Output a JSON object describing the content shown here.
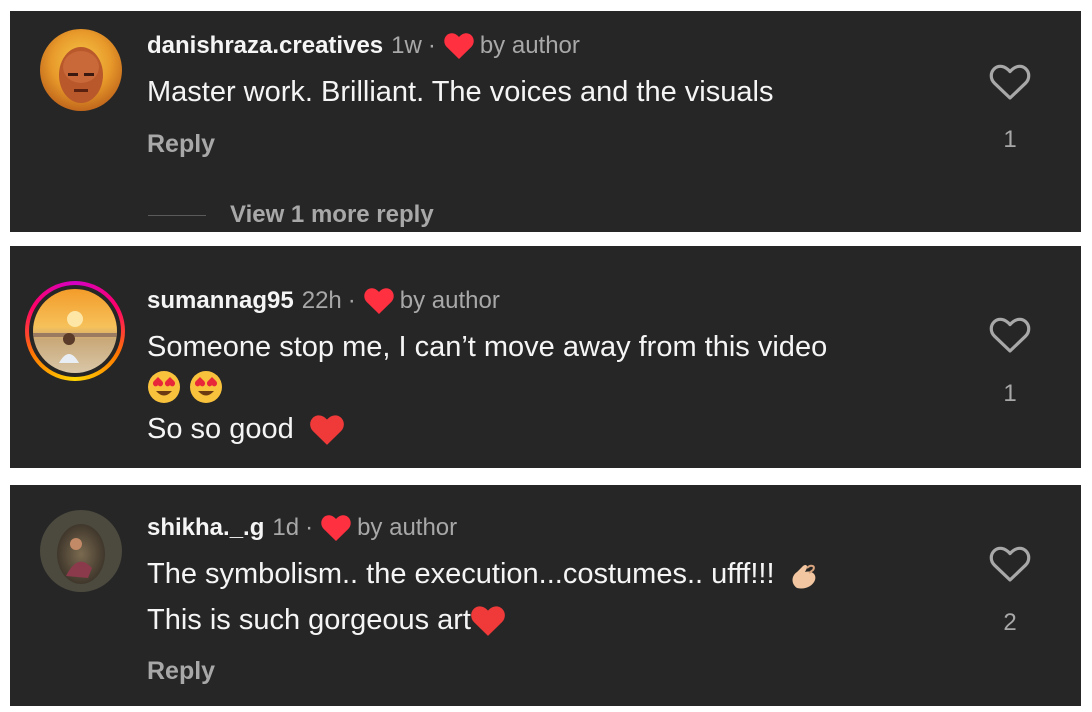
{
  "comments": [
    {
      "username": "danishraza.creatives",
      "time": "1w",
      "separator": "·",
      "by_author": "by author",
      "lines": [
        "Master work. Brilliant. The voices and the visuals"
      ],
      "reply_label": "Reply",
      "view_replies": "View 1 more reply",
      "like_count": "1"
    },
    {
      "username": "sumannag95",
      "time": "22h",
      "separator": "·",
      "by_author": "by author",
      "lines": [
        "Someone stop me, I can’t move away from this video",
        "So so good"
      ],
      "like_count": "1"
    },
    {
      "username": "shikha._.g",
      "time": "1d",
      "separator": "·",
      "by_author": "by author",
      "lines": [
        "The symbolism.. the execution...costumes.. ufff!!!",
        "This is such gorgeous art"
      ],
      "reply_label": "Reply",
      "like_count": "2"
    }
  ],
  "icons": {
    "liked_by_author": "red-heart-icon",
    "like_button": "heart-outline-icon",
    "emojis": [
      "heart-eyes-emoji",
      "red-heart-emoji",
      "pinching-hand-emoji"
    ]
  },
  "colors": {
    "background": "#262626",
    "primary_text": "#f5f5f5",
    "secondary_text": "#a8a8a8",
    "heart_red": "#ff3040"
  }
}
